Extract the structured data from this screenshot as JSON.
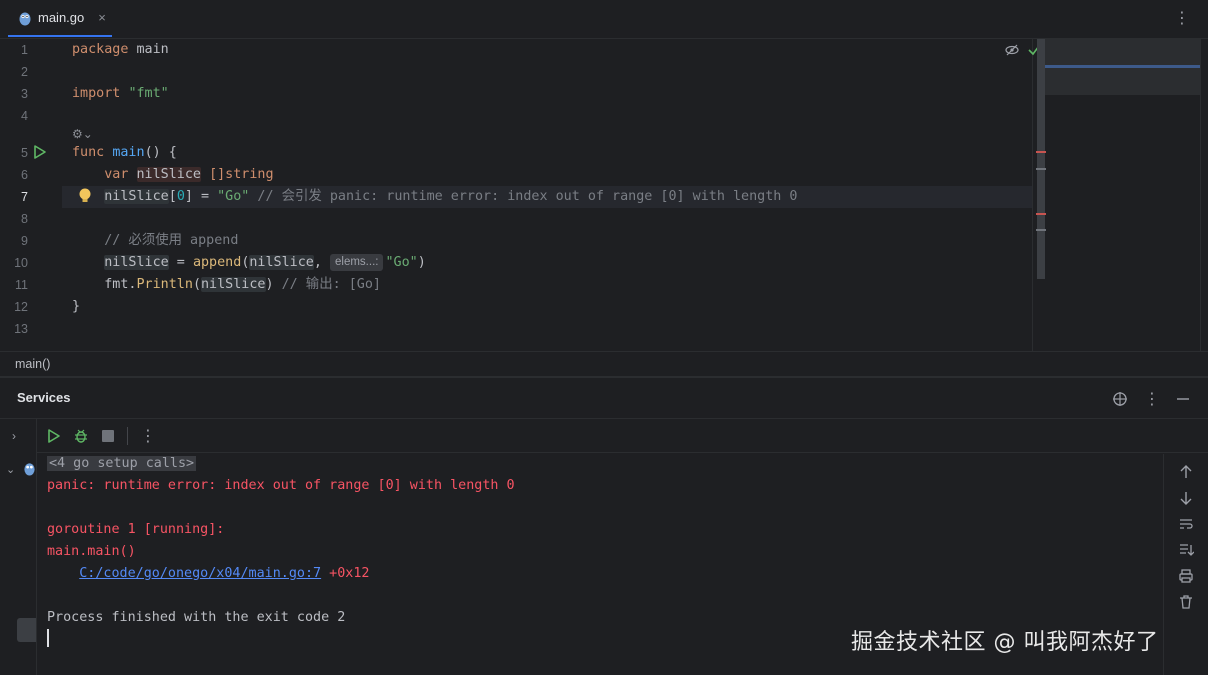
{
  "tab": {
    "filename": "main.go",
    "close_glyph": "×"
  },
  "editor": {
    "lines": [
      {
        "n": "1"
      },
      {
        "n": "2"
      },
      {
        "n": "3"
      },
      {
        "n": "4"
      },
      {
        "n": "5"
      },
      {
        "n": "6"
      },
      {
        "n": "7"
      },
      {
        "n": "8"
      },
      {
        "n": "9"
      },
      {
        "n": "10"
      },
      {
        "n": "11"
      },
      {
        "n": "12"
      },
      {
        "n": "13"
      }
    ],
    "code": {
      "l1_kw": "package",
      "l1_rest": " main",
      "l3_kw": "import",
      "l3_str": "\"fmt\"",
      "l5_kw": "func",
      "l5_fn": "main",
      "l5_rest": "() {",
      "l6_kw": "var",
      "l6_var": "nilSlice",
      "l6_type": "[]string",
      "l7_var": "nilSlice",
      "l7_idx_open": "[",
      "l7_idx": "0",
      "l7_idx_close": "]",
      "l7_eq": " = ",
      "l7_str": "\"Go\"",
      "l7_cmt": " // 会引发 panic: runtime error: index out of range [0] with length 0",
      "l9_cmt": "// 必须使用 append",
      "l10_var": "nilSlice",
      "l10_eq": " = ",
      "l10_fn": "append",
      "l10_open": "(",
      "l10_arg": "nilSlice",
      "l10_comma": ", ",
      "l10_hint": "elems...:",
      "l10_str": "\"Go\"",
      "l10_close": ")",
      "l11_pkg": "fmt.",
      "l11_fn": "Println",
      "l11_open": "(",
      "l11_arg": "nilSlice",
      "l11_close": ")",
      "l11_cmt": " // 输出: [Go]",
      "l12": "}"
    }
  },
  "breadcrumb": "main()",
  "services": {
    "title": "Services",
    "console": {
      "setup": "<4 go setup calls>",
      "panic": "panic: runtime error: index out of range [0] with length 0",
      "goroutine": "goroutine 1 [running]:",
      "frame": "main.main()",
      "link": "C:/code/go/onego/x04/main.go:7",
      "offset": " +0x12",
      "finished": "Process finished with the exit code 2"
    }
  },
  "watermark": "掘金技术社区 @ 叫我阿杰好了",
  "colors": {
    "background": "#1e1f22",
    "keyword": "#cf8e6d",
    "string": "#6aab73",
    "function": "#56a8f5",
    "error": "#f75464",
    "link": "#548af7",
    "run_green": "#5fb865"
  }
}
